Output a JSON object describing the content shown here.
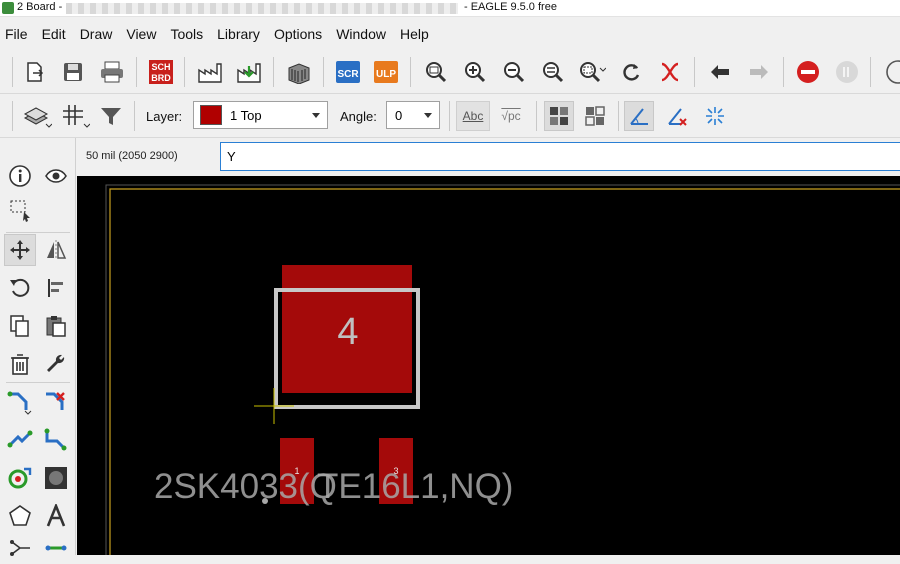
{
  "window": {
    "title_left": "2 Board -",
    "title_right": "- EAGLE 9.5.0 free"
  },
  "menu": [
    "File",
    "Edit",
    "Draw",
    "View",
    "Tools",
    "Library",
    "Options",
    "Window",
    "Help"
  ],
  "toolbar": {
    "sch_brd_label": "SCH\nBRD",
    "sch_label": "SCH",
    "brd_label": "BRD",
    "scr_label": "SCR",
    "ulp_label": "ULP"
  },
  "params": {
    "layer_label": "Layer:",
    "layer_value": "1 Top",
    "layer_color": "#b00000",
    "angle_label": "Angle:",
    "angle_value": "0",
    "abc_label": "Abc",
    "vpc_label": "√pc"
  },
  "command": {
    "coordinates": "50 mil (2050 2900)",
    "input_value": "Y"
  },
  "board": {
    "pad_number": "4",
    "pin_left_label": "1",
    "pin_right_label": "3",
    "part_text": "2SK4033(Q",
    "part_text_overlap": "TE16L1,NQ)",
    "pad_color": "#a40a0a",
    "background": "#000000",
    "outline_color": "#c8a020"
  }
}
